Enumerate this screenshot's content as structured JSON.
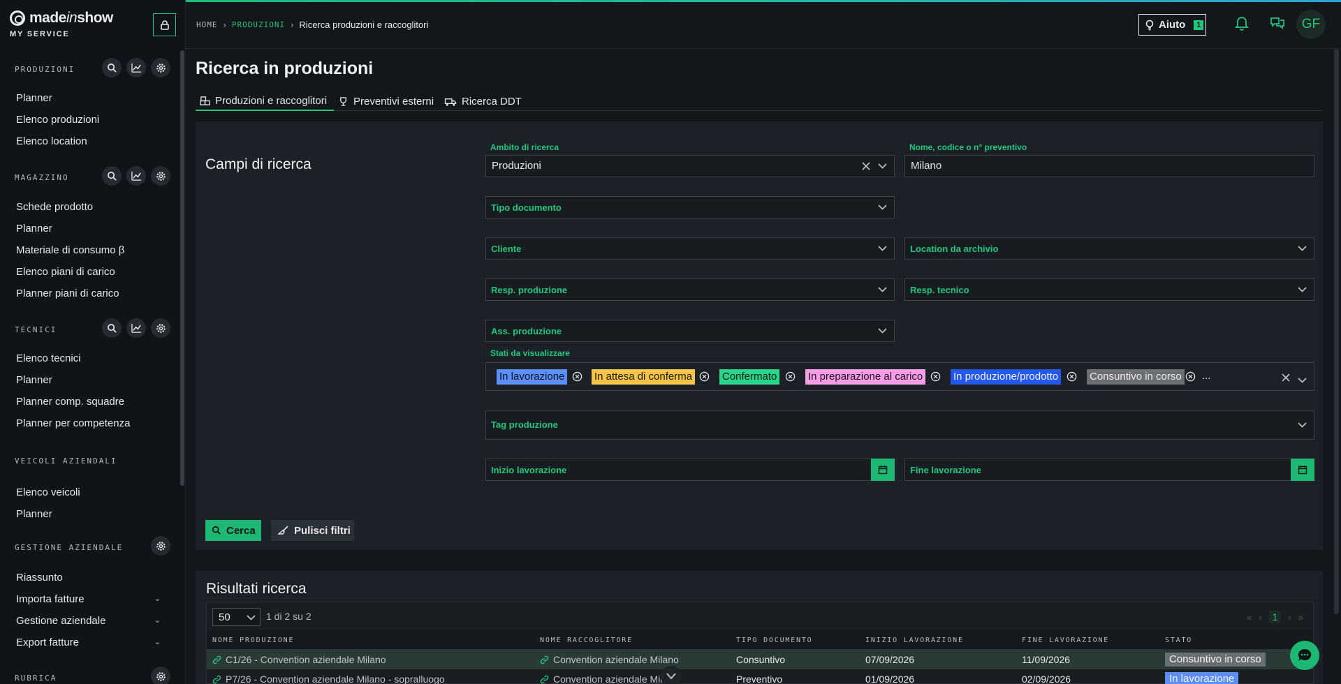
{
  "app": {
    "logo_text_made": "made",
    "logo_text_in": "in",
    "logo_text_show": "show",
    "logo_sub": "MY SERVICE"
  },
  "sidebar": {
    "sections": [
      {
        "title": "PRODUZIONI",
        "items": [
          "Planner",
          "Elenco produzioni",
          "Elenco location"
        ]
      },
      {
        "title": "MAGAZZINO",
        "items": [
          "Schede prodotto",
          "Planner",
          "Materiale di consumo β",
          "Elenco piani di carico",
          "Planner piani di carico"
        ]
      },
      {
        "title": "TECNICI",
        "items": [
          "Elenco tecnici",
          "Planner",
          "Planner comp. squadre",
          "Planner per competenza"
        ]
      },
      {
        "title": "VEICOLI AZIENDALI",
        "items": [
          "Elenco veicoli",
          "Planner"
        ]
      },
      {
        "title": "GESTIONE AZIENDALE",
        "items": [
          "Riassunto",
          "Importa fatture",
          "Gestione aziendale",
          "Export fatture"
        ]
      },
      {
        "title": "RUBRICA",
        "items": []
      }
    ]
  },
  "topbar": {
    "breadcrumb": {
      "home": "HOME",
      "section": "PRODUZIONI",
      "current": "Ricerca produzioni e raccoglitori"
    },
    "help_label": "Aiuto",
    "help_count": "1",
    "avatar_initials": "GF"
  },
  "page": {
    "title": "Ricerca in produzioni",
    "tabs": [
      "Produzioni e raccoglitori",
      "Preventivi esterni",
      "Ricerca DDT"
    ]
  },
  "search": {
    "panel_title": "Campi di ricerca",
    "ambito_label": "Ambito di ricerca",
    "ambito_value": "Produzioni",
    "nome_label": "Nome, codice o n° preventivo",
    "nome_value": "Milano",
    "tipo_documento": "Tipo documento",
    "cliente": "Cliente",
    "location": "Location da archivio",
    "resp_produzione": "Resp. produzione",
    "resp_tecnico": "Resp. tecnico",
    "ass_produzione": "Ass. produzione",
    "stati_label": "Stati da visualizzare",
    "stati": [
      {
        "label": "In lavorazione",
        "bg": "#5b8ff5",
        "fg": "#0c1320"
      },
      {
        "label": "In attesa di conferma",
        "bg": "#f3c44a",
        "fg": "#1f1a08"
      },
      {
        "label": "Confermato",
        "bg": "#2ad389",
        "fg": "#0b1f15"
      },
      {
        "label": "In preparazione al carico",
        "bg": "#f59ee6",
        "fg": "#24101f"
      },
      {
        "label": "In produzione/prodotto",
        "bg": "#2357e8",
        "fg": "#eef2ff"
      },
      {
        "label": "Consuntivo in corso",
        "bg": "#6b6e72",
        "fg": "#ececec"
      }
    ],
    "stati_more": "...",
    "tag_produzione": "Tag produzione",
    "inizio_lavorazione": "Inizio lavorazione",
    "fine_lavorazione": "Fine lavorazione",
    "btn_cerca": "Cerca",
    "btn_pulisci": "Pulisci filtri"
  },
  "results": {
    "title": "Risultati ricerca",
    "page_size": "50",
    "page_info": "1 di 2 su 2",
    "current_page": "1",
    "columns": [
      "NOME PRODUZIONE",
      "NOME RACCOGLITORE",
      "TIPO DOCUMENTO",
      "INIZIO LAVORAZIONE",
      "FINE LAVORAZIONE",
      "STATO"
    ],
    "rows": [
      {
        "nome": "C1/26 - Convention aziendale Milano",
        "raccoglitore": "Convention aziendale Milano",
        "tipo": "Consuntivo",
        "inizio": "07/09/2026",
        "fine": "11/09/2026",
        "stato": "Consuntivo in corso",
        "stato_bg": "#6b6e72"
      },
      {
        "nome": "P7/26 - Convention aziendale Milano - sopralluogo",
        "raccoglitore": "Convention aziendale Milano",
        "tipo": "Preventivo",
        "inizio": "01/09/2026",
        "fine": "02/09/2026",
        "stato": "In lavorazione",
        "stato_bg": "#5b8ff5"
      }
    ]
  }
}
